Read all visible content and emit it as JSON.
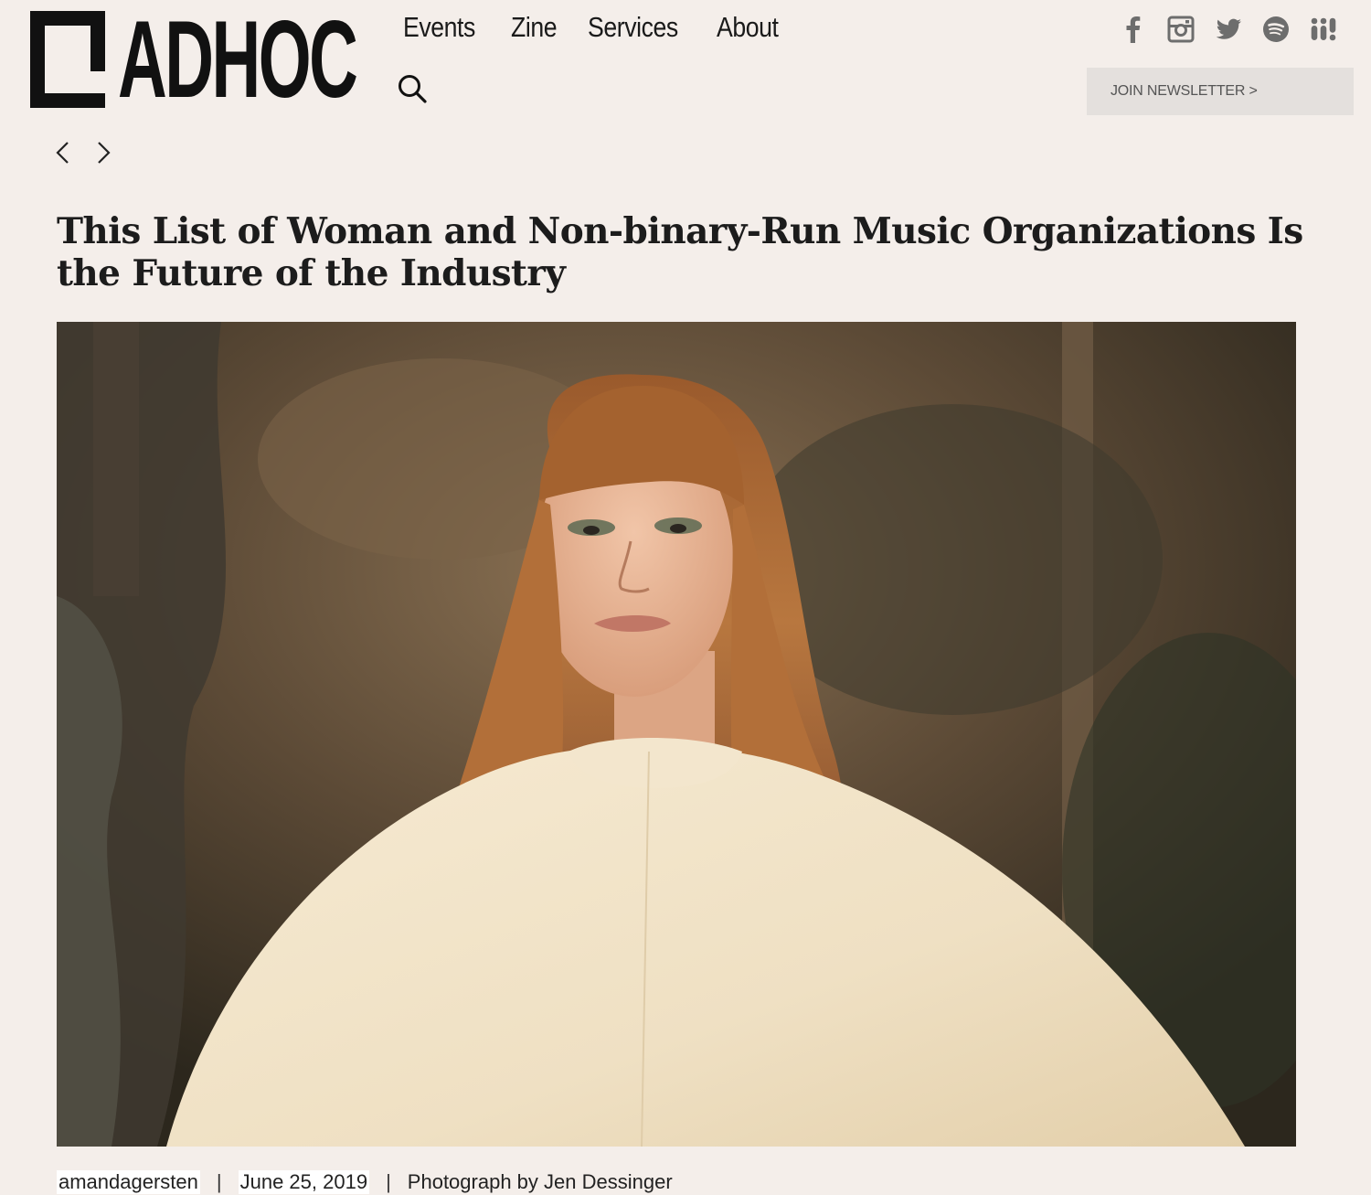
{
  "header": {
    "logo_text": "ADHOC",
    "nav": [
      "Events",
      "Zine",
      "Services",
      "About"
    ],
    "newsletter_label": "JOIN NEWSLETTER >",
    "social": [
      "facebook-icon",
      "instagram-icon",
      "twitter-icon",
      "spotify-icon",
      "bandcamp-icon"
    ]
  },
  "article": {
    "title": "This List of Woman and Non-binary-Run Music Organizations Is the Future of the Industry",
    "author": "amandagersten",
    "separator": "|",
    "date": "June 25, 2019",
    "credit": "Photograph by Jen Dessinger"
  },
  "colors": {
    "background": "#f4eeea",
    "newsletter_bg": "#e4e0dd",
    "text": "#1a1a1a",
    "icon": "#6d6d6d"
  }
}
